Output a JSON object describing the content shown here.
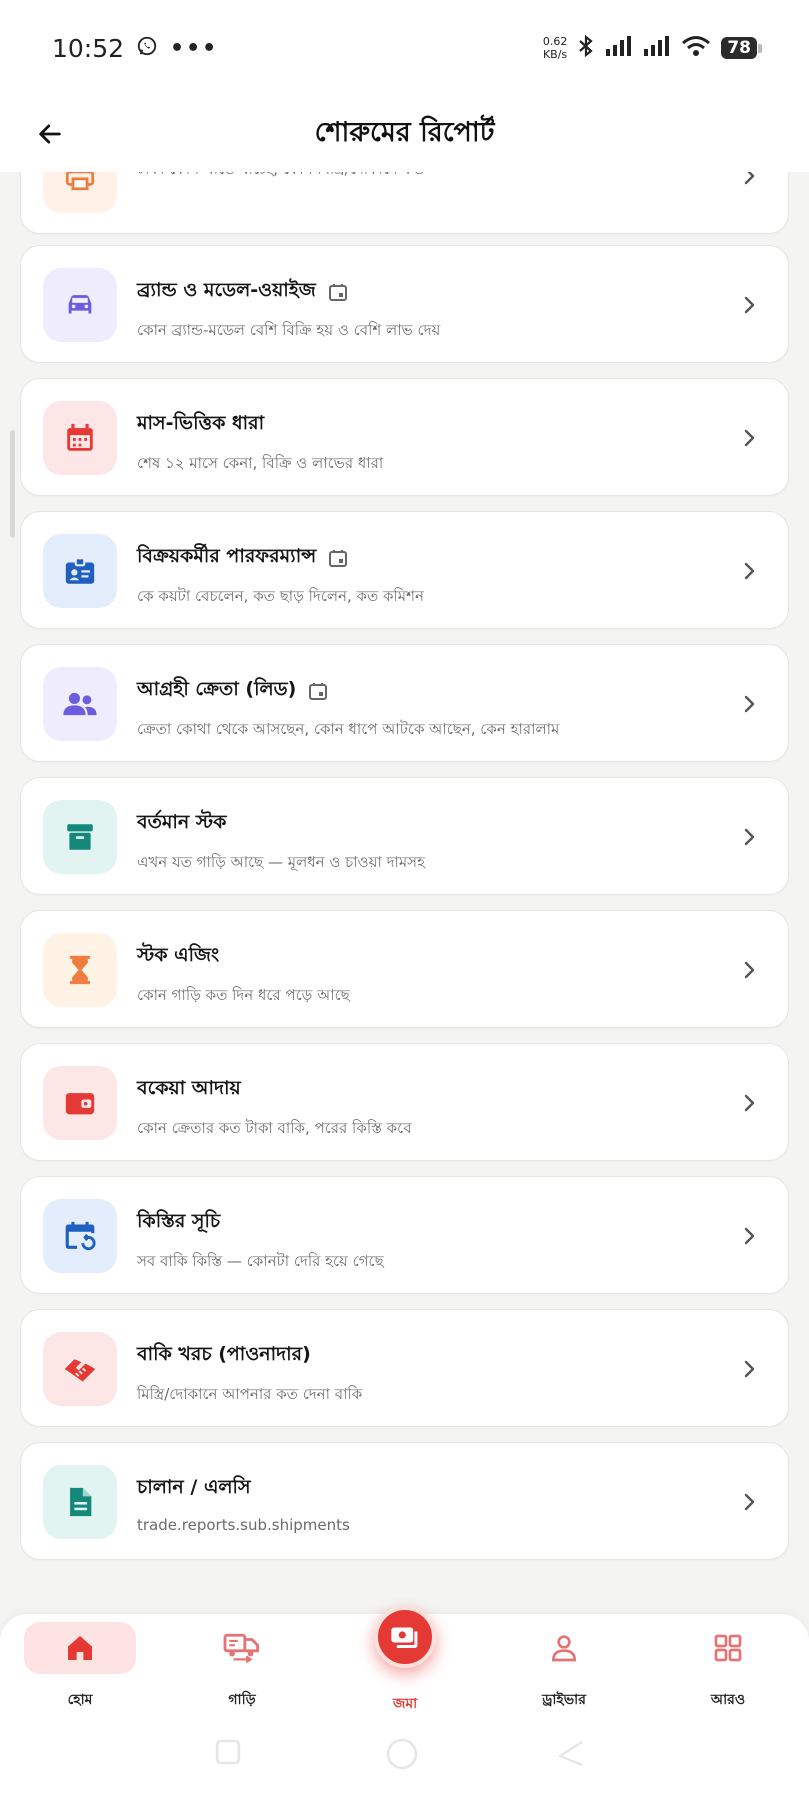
{
  "status_bar": {
    "time": "10:52",
    "net_speed_value": "0.62",
    "net_speed_unit": "KB/s",
    "battery": "78"
  },
  "header": {
    "title": "শোরুমের রিপোর্ট"
  },
  "reports": [
    {
      "title": "",
      "subtitle": "টাকা কোন খাতে যাচ্ছে, কোন মিস্ত্রি/দোকানে কত",
      "icon": "printer-icon",
      "color": "#f07b3f",
      "bg": "#fff1e8",
      "date_icon": false
    },
    {
      "title": "ব্র্যান্ড ও মডেল-ওয়াইজ",
      "subtitle": "কোন ব্র্যান্ড-মডেল বেশি বিক্রি হয় ও বেশি লাভ দেয়",
      "icon": "car-icon",
      "color": "#6b5ce0",
      "bg": "#efecfd",
      "date_icon": true
    },
    {
      "title": "মাস-ভিত্তিক ধারা",
      "subtitle": "শেষ ১২ মাসে কেনা, বিক্রি ও লাভের ধারা",
      "icon": "calendar-icon",
      "color": "#e53935",
      "bg": "#fde7e6",
      "date_icon": false
    },
    {
      "title": "বিক্রয়কর্মীর পারফরম্যান্স",
      "subtitle": "কে কয়টা বেচলেন, কত ছাড় দিলেন, কত কমিশন",
      "icon": "id-badge-icon",
      "color": "#1e5fbf",
      "bg": "#e3edfb",
      "date_icon": true
    },
    {
      "title": "আগ্রহী ক্রেতা (লিড)",
      "subtitle": "ক্রেতা কোথা থেকে আসছেন, কোন ধাপে আটকে আছেন, কেন হারালাম",
      "icon": "people-icon",
      "color": "#6b5ce0",
      "bg": "#efecfd",
      "date_icon": true
    },
    {
      "title": "বর্তমান স্টক",
      "subtitle": "এখন যত গাড়ি আছে — মূলধন ও চাওয়া দামসহ",
      "icon": "archive-box-icon",
      "color": "#14897a",
      "bg": "#e2f4f1",
      "date_icon": false
    },
    {
      "title": "স্টক এজিং",
      "subtitle": "কোন গাড়ি কত দিন ধরে পড়ে আছে",
      "icon": "hourglass-icon",
      "color": "#f07b3f",
      "bg": "#fff3e6",
      "date_icon": false
    },
    {
      "title": "বকেয়া আদায়",
      "subtitle": "কোন ক্রেতার কত টাকা বাকি, পরের কিস্তি কবে",
      "icon": "wallet-icon",
      "color": "#e53935",
      "bg": "#fde7e6",
      "date_icon": false
    },
    {
      "title": "কিস্তির সূচি",
      "subtitle": "সব বাকি কিস্তি — কোনটা দেরি হয়ে গেছে",
      "icon": "calendar-repeat-icon",
      "color": "#1e5fbf",
      "bg": "#e3edfb",
      "date_icon": false
    },
    {
      "title": "বাকি খরচ (পাওনাদার)",
      "subtitle": "মিস্ত্রি/দোকানে আপনার কত দেনা বাকি",
      "icon": "handshake-icon",
      "color": "#e53935",
      "bg": "#fde7e6",
      "date_icon": false
    },
    {
      "title": "চালান / এলসি",
      "subtitle": "trade.reports.sub.shipments",
      "icon": "document-icon",
      "color": "#14897a",
      "bg": "#e2f4f1",
      "date_icon": false
    }
  ],
  "bottom_nav": {
    "home": "হোম",
    "vehicles": "গাড়ি",
    "deposit": "জমা",
    "driver": "ড্রাইভার",
    "more": "আরও"
  },
  "colors": {
    "accent": "#e53935",
    "active_bg": "#fde3e1"
  }
}
